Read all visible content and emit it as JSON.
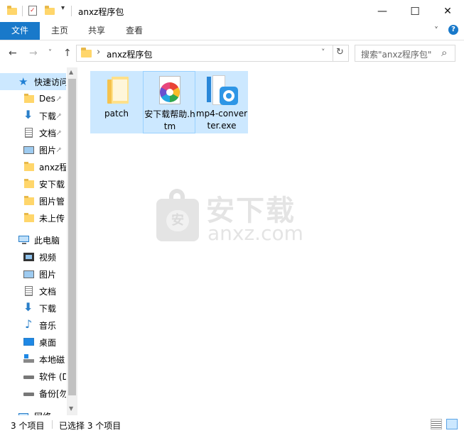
{
  "window": {
    "title": "anxz程序包",
    "minimize": "—",
    "maximize": "☐",
    "close": "✕"
  },
  "ribbon": {
    "tabs": [
      {
        "label": "文件",
        "active": true
      },
      {
        "label": "主页"
      },
      {
        "label": "共享"
      },
      {
        "label": "查看"
      }
    ],
    "expand_icon": "˅",
    "help_icon": "?"
  },
  "address": {
    "path_separator": "›",
    "path": "anxz程序包",
    "search_placeholder": "搜索\"anxz程序包\"",
    "back_icon": "←",
    "forward_icon": "→",
    "recent_icon": "˅",
    "up_icon": "↑",
    "dropdown_icon": "˅",
    "refresh_icon": "↻",
    "search_icon": "⌕"
  },
  "nav": {
    "quick_access": "快速访问",
    "quick_items": [
      {
        "label": "Des",
        "pinned": true,
        "icon": "folder-blue"
      },
      {
        "label": "下载",
        "pinned": true,
        "icon": "download"
      },
      {
        "label": "文档",
        "pinned": true,
        "icon": "document"
      },
      {
        "label": "图片",
        "pinned": true,
        "icon": "picture"
      },
      {
        "label": "anxz程",
        "icon": "folder"
      },
      {
        "label": "安下载",
        "icon": "folder"
      },
      {
        "label": "图片管",
        "icon": "folder"
      },
      {
        "label": "未上传",
        "icon": "folder"
      }
    ],
    "this_pc": "此电脑",
    "pc_items": [
      {
        "label": "视频",
        "icon": "video"
      },
      {
        "label": "图片",
        "icon": "picture"
      },
      {
        "label": "文档",
        "icon": "document"
      },
      {
        "label": "下载",
        "icon": "download"
      },
      {
        "label": "音乐",
        "icon": "music"
      },
      {
        "label": "桌面",
        "icon": "desktop"
      },
      {
        "label": "本地磁",
        "icon": "drive-os"
      },
      {
        "label": "软件 (D",
        "icon": "drive"
      },
      {
        "label": "备份[勿",
        "icon": "drive"
      }
    ],
    "network": "网络",
    "pin_icon": "📌"
  },
  "files": [
    {
      "name": "patch",
      "type": "folder"
    },
    {
      "name": "安下载帮助.htm",
      "type": "htm"
    },
    {
      "name": "mp4-converter.exe",
      "type": "exe"
    }
  ],
  "watermark": {
    "cn": "安下载",
    "en": "anxz.com",
    "badge": "安"
  },
  "status": {
    "count": "3 个项目",
    "selected": "已选择 3 个项目"
  },
  "colors": {
    "accent": "#1979ca",
    "selection": "#cce8ff",
    "selection_border": "#99d1ff",
    "folder": "#ffd66b"
  }
}
